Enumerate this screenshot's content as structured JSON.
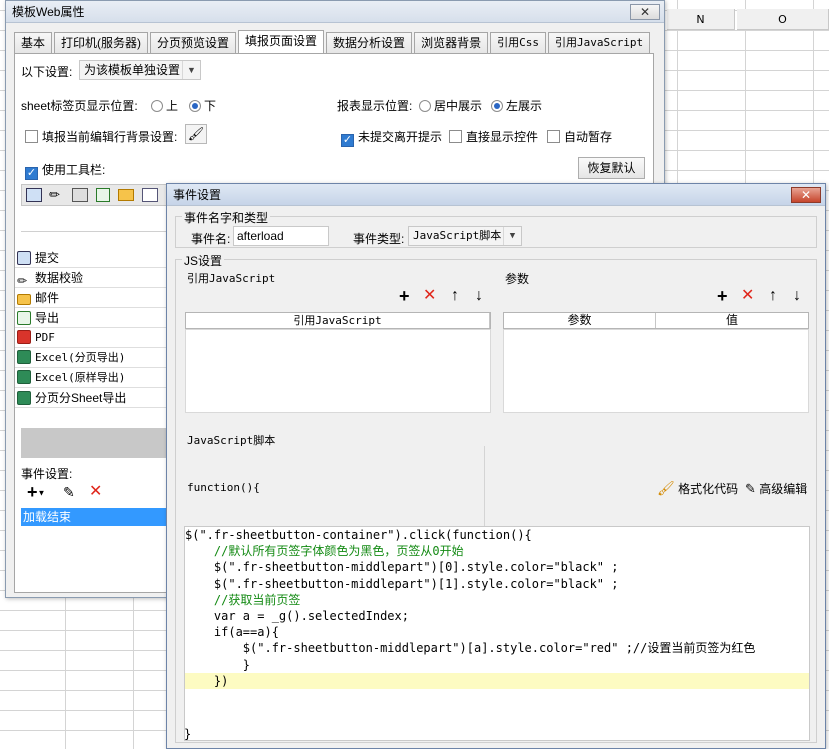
{
  "sheet": {
    "col_n": "N",
    "col_o": "O"
  },
  "main_window": {
    "title": "模板Web属性",
    "close_symbol": "✕",
    "tabs": [
      "基本",
      "打印机(服务器)",
      "分页预览设置",
      "填报页面设置",
      "数据分析设置",
      "浏览器背景",
      "引用Css",
      "引用JavaScript"
    ],
    "active_tab": "填报页面设置",
    "settings_label": "以下设置:",
    "settings_value": "为该模板单独设置",
    "sheet_tab_pos_label": "sheet标签页显示位置:",
    "sheet_tab_opt_top": "上",
    "sheet_tab_opt_bottom": "下",
    "report_pos_label": "报表显示位置:",
    "report_opt_center": "居中展示",
    "report_opt_left": "左展示",
    "fill_bg_label": "填报当前编辑行背景设置:",
    "unsubmitted_label": "未提交离开提示",
    "direct_show_label": "直接显示控件",
    "auto_save_label": "自动暂存",
    "use_toolbar_label": "使用工具栏:",
    "restore_default": "恢复默认",
    "toolbar_items": [
      "提交",
      "数据校验",
      "邮件",
      "导出",
      "PDF",
      "Excel(分页导出)",
      "Excel(原样导出)",
      "分页分Sheet导出"
    ],
    "event_settings_label": "事件设置:",
    "event_items": [
      "加载结束"
    ]
  },
  "event_dialog": {
    "title": "事件设置",
    "group_name_type": "事件名字和类型",
    "event_name_label": "事件名:",
    "event_name_value": "afterload",
    "event_type_label": "事件类型:",
    "event_type_value": "JavaScript脚本",
    "group_js": "JS设置",
    "ref_js_label": "引用JavaScript",
    "params_label": "参数",
    "ref_js_col": "引用JavaScript",
    "param_col": "参数",
    "value_col": "值",
    "js_script_label": "JavaScript脚本",
    "function_header": "function(){",
    "format_code": "格式化代码",
    "advanced_edit": "高级编辑",
    "code_lines": [
      "$(\".fr-sheetbutton-container\").click(function(){",
      "    //默认所有页签字体颜色为黑色，页签从0开始",
      "    $(\".fr-sheetbutton-middlepart\")[0].style.color=\"black\" ;",
      "    $(\".fr-sheetbutton-middlepart\")[1].style.color=\"black\" ;",
      "    //获取当前页签",
      "    var a = _g().selectedIndex;",
      "    if(a==a){",
      "        $(\".fr-sheetbutton-middlepart\")[a].style.color=\"red\" ;//设置当前页签为红色",
      "        }",
      "    })"
    ],
    "closing_brace": "}"
  },
  "colors": {
    "accent": "#2f7bd1",
    "selection": "#3399ff",
    "close_red": "#c6452c"
  }
}
